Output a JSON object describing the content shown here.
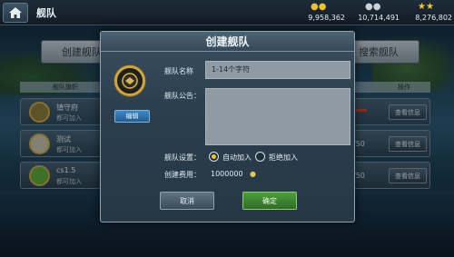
{
  "topbar": {
    "title": "舰队",
    "resources": [
      {
        "icon": "gold-coins-icon",
        "value": "9,958,362",
        "color": "#e6c13a"
      },
      {
        "icon": "silver-coins-icon",
        "value": "10,714,491",
        "color": "#c9d2d8"
      },
      {
        "icon": "stars-icon",
        "value": "8,276,802",
        "color": "#f0c93c"
      }
    ]
  },
  "tabs": {
    "create_label": "创建舰队",
    "search_label": "搜索舰队"
  },
  "list": {
    "header_name": "舰队旗帜",
    "header_right": "操作",
    "rows": [
      {
        "name": "镇守府",
        "state": "都可加入",
        "count": "",
        "action": "查看信息",
        "emblem_color": "#8a7a3a"
      },
      {
        "name": "测试",
        "state": "都可加入",
        "count": "/50",
        "action": "查看信息",
        "emblem_color": "#c8c0a8"
      },
      {
        "name": "cs1.5",
        "state": "都可加入",
        "count": "/50",
        "action": "查看信息",
        "emblem_color": "#5aa832"
      }
    ]
  },
  "dialog": {
    "title": "创建舰队",
    "edit_label": "编辑",
    "name_label": "舰队名称",
    "name_placeholder": "1-14个字符",
    "notice_label": "舰队公告：",
    "settings_label": "舰队设置：",
    "option_auto": "自动加入",
    "option_reject": "拒绝加入",
    "cost_label": "创建费用：",
    "cost_value": "1000000",
    "cancel_label": "取消",
    "confirm_label": "确定",
    "colors": {
      "confirm": "#3f8a30",
      "edit": "#2f74ad",
      "accent": "#f1c232"
    }
  }
}
